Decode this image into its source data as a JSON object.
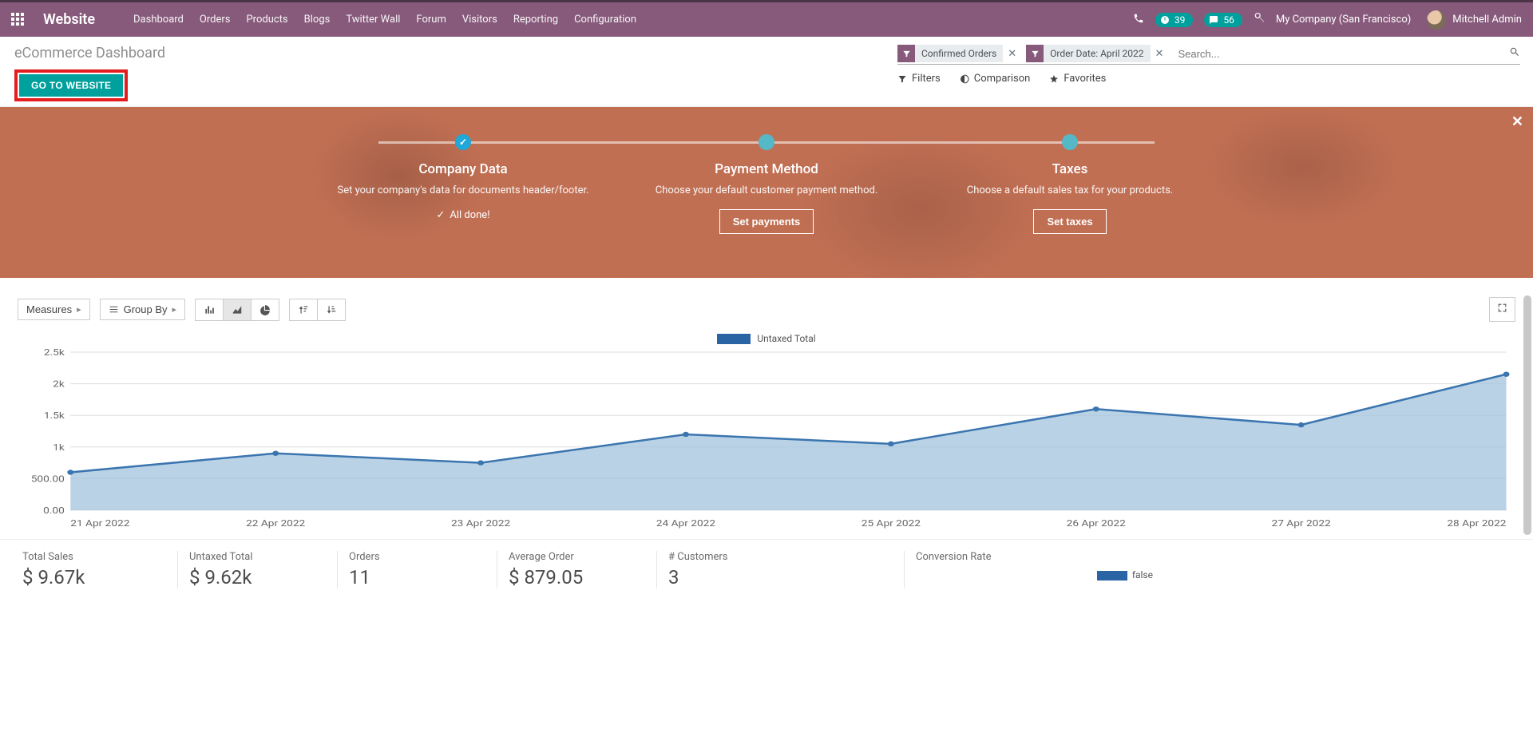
{
  "brand": "Website",
  "menu": [
    "Dashboard",
    "Orders",
    "Products",
    "Blogs",
    "Twitter Wall",
    "Forum",
    "Visitors",
    "Reporting",
    "Configuration"
  ],
  "badges": {
    "clock": "39",
    "chat": "56"
  },
  "company": "My Company (San Francisco)",
  "user": "Mitchell Admin",
  "page_title": "eCommerce Dashboard",
  "go_to_website": "GO TO WEBSITE",
  "search": {
    "placeholder": "Search...",
    "facets": [
      "Confirmed Orders",
      "Order Date: April 2022"
    ],
    "filters": "Filters",
    "comparison": "Comparison",
    "favorites": "Favorites"
  },
  "onboarding": {
    "steps": [
      {
        "title": "Company Data",
        "desc": "Set your company's data for documents header/footer.",
        "done_label": "All done!"
      },
      {
        "title": "Payment Method",
        "desc": "Choose your default customer payment method.",
        "cta": "Set payments"
      },
      {
        "title": "Taxes",
        "desc": "Choose a default sales tax for your products.",
        "cta": "Set taxes"
      }
    ]
  },
  "toolbar": {
    "measures": "Measures",
    "group_by": "Group By"
  },
  "chart_legend": "Untaxed Total",
  "chart_data": {
    "type": "line",
    "title": "",
    "xlabel": "",
    "ylabel": "",
    "ylim": [
      0,
      2500
    ],
    "y_ticks": [
      "0.00",
      "500.00",
      "1k",
      "1.5k",
      "2k",
      "2.5k"
    ],
    "categories": [
      "21 Apr 2022",
      "22 Apr 2022",
      "23 Apr 2022",
      "24 Apr 2022",
      "25 Apr 2022",
      "26 Apr 2022",
      "27 Apr 2022",
      "28 Apr 2022"
    ],
    "series": [
      {
        "name": "Untaxed Total",
        "color": "#3b75af",
        "fill": "#a2c3de",
        "values": [
          600,
          900,
          750,
          1200,
          1050,
          1600,
          1350,
          2150
        ]
      }
    ]
  },
  "kpis": [
    {
      "label": "Total Sales",
      "value": "$ 9.67k"
    },
    {
      "label": "Untaxed Total",
      "value": "$ 9.62k"
    },
    {
      "label": "Orders",
      "value": "11"
    },
    {
      "label": "Average Order",
      "value": "$ 879.05"
    },
    {
      "label": "# Customers",
      "value": "3"
    },
    {
      "label": "Conversion Rate",
      "value": "",
      "legend": "false"
    }
  ],
  "colors": {
    "accent": "#00a09d",
    "chart_line": "#2a64a5",
    "chart_fill": "#a2c3de"
  }
}
